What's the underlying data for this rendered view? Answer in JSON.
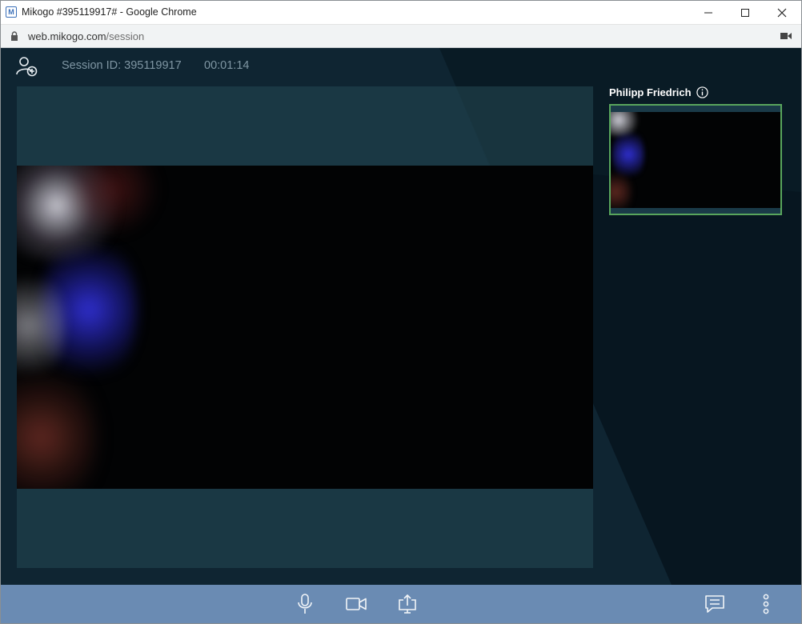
{
  "window": {
    "title": "Mikogo #395119917# - Google Chrome",
    "app_icon": "M"
  },
  "address_bar": {
    "domain": "web.mikogo.com",
    "path": "/session"
  },
  "session": {
    "id_text": "Session ID: 395119917",
    "timer": "00:01:14"
  },
  "participant": {
    "name": "Philipp Friedrich"
  },
  "colors": {
    "toolbar": "#6a8bb3",
    "background": "#0f2532",
    "thumb_border": "#58a55c"
  },
  "icons": {
    "toolbar": [
      "microphone-icon",
      "video-camera-icon",
      "share-screen-icon",
      "chat-icon",
      "more-options-icon"
    ],
    "header": [
      "add-participant-icon",
      "info-icon"
    ],
    "window": [
      "minimize-icon",
      "maximize-icon",
      "close-icon",
      "lock-icon",
      "camera-in-use-icon"
    ]
  }
}
